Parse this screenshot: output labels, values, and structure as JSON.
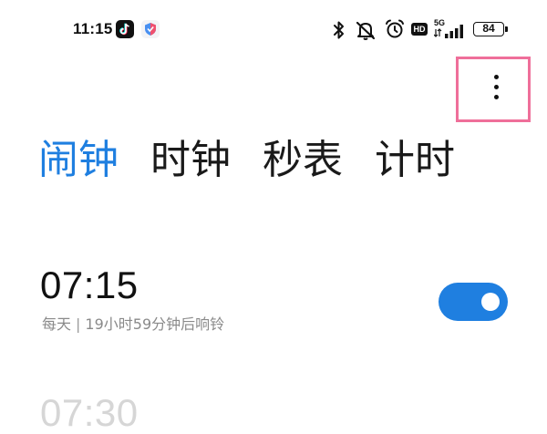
{
  "status_bar": {
    "time": "11:15",
    "network_type": "5G",
    "battery_level": "84",
    "hd_label": "HD",
    "icons": [
      "tiktok-icon",
      "shield-app-icon",
      "bluetooth-icon",
      "mute-icon",
      "alarm-clock-icon",
      "hd-icon",
      "signal-icon",
      "battery-icon"
    ]
  },
  "toolbar": {
    "more_icon": "more-vertical-icon",
    "highlight_color": "#ef6f9a"
  },
  "tabs": [
    {
      "label": "闹钟",
      "active": true
    },
    {
      "label": "时钟",
      "active": false
    },
    {
      "label": "秒表",
      "active": false
    },
    {
      "label": "计时",
      "active": false
    }
  ],
  "alarms": [
    {
      "time": "07:15",
      "repeat": "每天",
      "detail": "19小时59分钟后响铃",
      "enabled": true
    },
    {
      "time": "07:30"
    }
  ],
  "colors": {
    "accent": "#1f7fe0",
    "text": "#1a1a1a",
    "subtext": "#8a8a8a"
  }
}
